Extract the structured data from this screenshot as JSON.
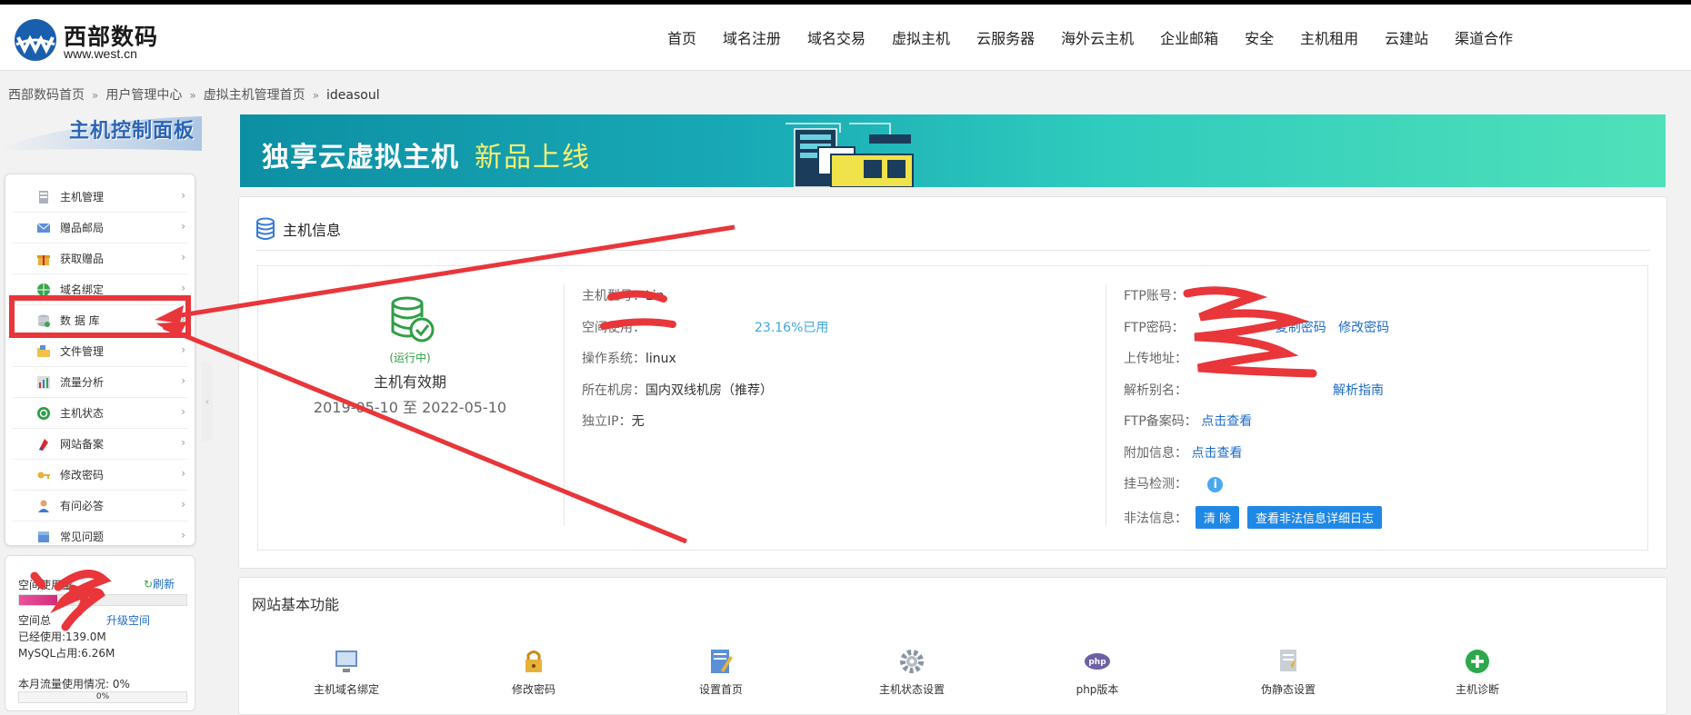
{
  "brand": {
    "name": "西部数码",
    "domain": "www.west.cn"
  },
  "nav": [
    "首页",
    "域名注册",
    "域名交易",
    "虚拟主机",
    "云服务器",
    "海外云主机",
    "企业邮箱",
    "安全",
    "主机租用",
    "云建站",
    "渠道合作"
  ],
  "breadcrumb": [
    "西部数码首页",
    "用户管理中心",
    "虚拟主机管理首页",
    "ideasoul"
  ],
  "sidebar": {
    "title": "主机控制面板",
    "items": [
      {
        "label": "主机管理",
        "icon": "server-icon"
      },
      {
        "label": "赠品邮局",
        "icon": "mail-icon"
      },
      {
        "label": "获取赠品",
        "icon": "gift-icon"
      },
      {
        "label": "域名绑定",
        "icon": "globe-icon"
      },
      {
        "label": "数 据 库",
        "icon": "database-icon"
      },
      {
        "label": "文件管理",
        "icon": "folder-icon"
      },
      {
        "label": "流量分析",
        "icon": "chart-icon"
      },
      {
        "label": "主机状态",
        "icon": "status-icon"
      },
      {
        "label": "网站备案",
        "icon": "filing-icon"
      },
      {
        "label": "修改密码",
        "icon": "key-icon"
      },
      {
        "label": "有问必答",
        "icon": "user-help-icon"
      },
      {
        "label": "常见问题",
        "icon": "faq-icon"
      }
    ],
    "chevron": "›",
    "collapse": "‹"
  },
  "usage": {
    "space_used_label": "空间使用量",
    "refresh": "刷新",
    "space_total_label": "空间总",
    "upgrade": "升级空间",
    "used": "已经使用:139.0M",
    "mysql": "MySQL占用:6.26M",
    "traffic": "本月流量使用情况: 0%",
    "traffic_bar": "0%",
    "space_fill": 0.23,
    "traffic_fill": 0
  },
  "banner": {
    "title": "独享云虚拟主机",
    "subtitle": "新品上线"
  },
  "host_info": {
    "title": "主机信息",
    "status": "(运行中)",
    "validity_label": "主机有效期",
    "dates": "2019-05-10 至 2022-05-10",
    "mid": [
      {
        "k": "主机型号：",
        "v": "Lin"
      },
      {
        "k": "空间使用：",
        "v": "",
        "pct": "23.16%已用"
      },
      {
        "k": "操作系统：",
        "v": "linux"
      },
      {
        "k": "所在机房：",
        "v": "国内双线机房（推荐）"
      },
      {
        "k": "独立IP：",
        "v": "无"
      }
    ],
    "right": {
      "ftp_account": "FTP账号：",
      "ftp_password": "FTP密码：",
      "copy_pwd": "复制密码",
      "change_pwd": "修改密码",
      "upload_addr": "上传地址：",
      "alias": "解析别名：",
      "alias_guide": "解析指南",
      "ftp_filing": "FTP备案码：",
      "ftp_filing_link": "点击查看",
      "extra": "附加信息：",
      "extra_link": "点击查看",
      "malware": "挂马检测：",
      "illegal": "非法信息：",
      "clear_btn": "清 除",
      "log_btn": "查看非法信息详细日志"
    }
  },
  "features": {
    "title": "网站基本功能",
    "items": [
      {
        "label": "主机域名绑定",
        "icon": "monitor-icon"
      },
      {
        "label": "修改密码",
        "icon": "lock-icon"
      },
      {
        "label": "设置首页",
        "icon": "edit-page-icon"
      },
      {
        "label": "主机状态设置",
        "icon": "gear-icon"
      },
      {
        "label": "php版本",
        "icon": "php-icon"
      },
      {
        "label": "伪静态设置",
        "icon": "document-icon"
      },
      {
        "label": "主机诊断",
        "icon": "plus-icon"
      }
    ]
  },
  "colors": {
    "accent": "#1f88e5",
    "annotation": "#e8363a",
    "running": "#2e9e45"
  }
}
